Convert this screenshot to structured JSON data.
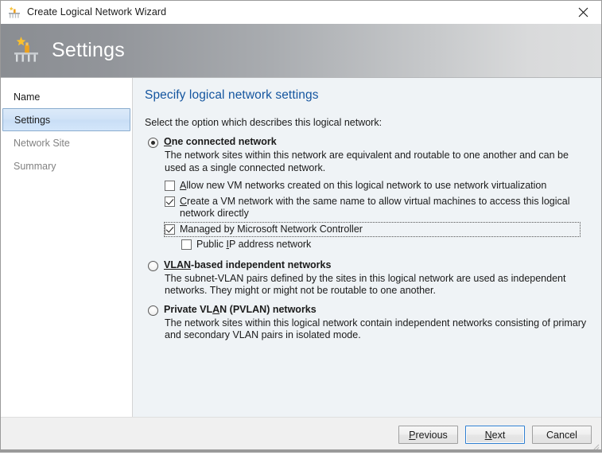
{
  "window": {
    "title": "Create Logical Network Wizard",
    "title_icon": "network-wizard-icon",
    "close_icon": "close-icon"
  },
  "header": {
    "title": "Settings",
    "icon": "network-wizard-large-icon"
  },
  "sidebar": {
    "items": [
      {
        "label": "Name",
        "state": "done"
      },
      {
        "label": "Settings",
        "state": "selected"
      },
      {
        "label": "Network Site",
        "state": "disabled"
      },
      {
        "label": "Summary",
        "state": "disabled"
      }
    ]
  },
  "main": {
    "heading": "Specify logical network settings",
    "intro": "Select the option which describes this logical network:",
    "options": [
      {
        "id": "one-connected-network",
        "label_pre": "",
        "label_accel": "O",
        "label_post": "ne connected network",
        "selected": true,
        "description": "The network sites within this network are equivalent and routable to one another and can be used as a single connected network.",
        "checkboxes": [
          {
            "id": "allow-network-virtualization",
            "label_pre": "",
            "label_accel": "A",
            "label_post": "llow new VM networks created on this logical network to use network virtualization",
            "checked": false,
            "indent": 1,
            "focused": false
          },
          {
            "id": "create-vm-network",
            "label_pre": "",
            "label_accel": "C",
            "label_post": "reate a VM network with the same name to allow virtual machines to access this logical network directly",
            "checked": true,
            "indent": 1,
            "focused": false
          },
          {
            "id": "managed-by-network-controller",
            "label_pre": "Managed by Microsoft Network Controller",
            "label_accel": "",
            "label_post": "",
            "checked": true,
            "indent": 1,
            "focused": true
          },
          {
            "id": "public-ip-address-network",
            "label_pre": "Public ",
            "label_accel": "I",
            "label_post": "P address network",
            "checked": false,
            "indent": 2,
            "focused": false
          }
        ]
      },
      {
        "id": "vlan-based-independent-networks",
        "label_pre": "",
        "label_accel": "VLAN",
        "label_post": "-based independent networks",
        "selected": false,
        "description": "The subnet-VLAN pairs defined by the sites in this logical network are used as independent networks. They might or might not be routable to one another.",
        "checkboxes": []
      },
      {
        "id": "private-vlan-networks",
        "label_pre": "Private VL",
        "label_accel": "A",
        "label_post": "N (PVLAN) networks",
        "selected": false,
        "description": "The network sites within this logical network contain independent networks consisting of primary and secondary VLAN pairs in isolated mode.",
        "checkboxes": []
      }
    ]
  },
  "footer": {
    "buttons": [
      {
        "id": "previous",
        "pre": "",
        "accel": "P",
        "post": "revious",
        "default": false
      },
      {
        "id": "next",
        "pre": "",
        "accel": "N",
        "post": "ext",
        "default": true
      },
      {
        "id": "cancel",
        "pre": "Cancel",
        "accel": "",
        "post": "",
        "default": false
      }
    ]
  },
  "colors": {
    "heading": "#14559f",
    "content_bg": "#eff3f6",
    "selected_nav": "#cfe2f7",
    "default_button_border": "#2f7fd1"
  }
}
